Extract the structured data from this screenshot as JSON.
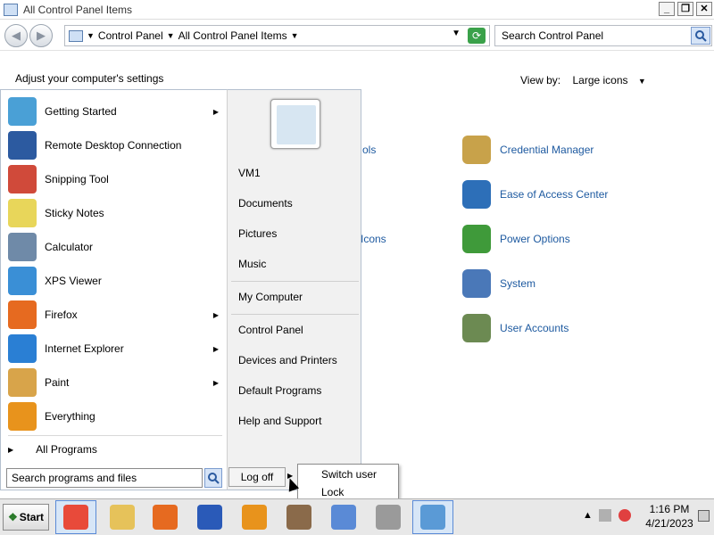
{
  "window": {
    "title": "All Control Panel Items",
    "buttons": [
      "_",
      "❐",
      "✕"
    ]
  },
  "toolbar": {
    "back_icon": "back-arrow-icon",
    "forward_icon": "forward-arrow-icon",
    "breadcrumb": [
      "Control Panel",
      "All Control Panel Items"
    ],
    "search_placeholder": "Search Control Panel"
  },
  "content": {
    "heading": "Adjust your computer's settings",
    "view_by_label": "View by:",
    "view_by_value": "Large icons",
    "partial_items": [
      "ols",
      "Icons"
    ],
    "items": [
      {
        "label": "Credential Manager",
        "color": "#c8a24a"
      },
      {
        "label": "Ease of Access Center",
        "color": "#2d6fb8"
      },
      {
        "label": "Power Options",
        "color": "#3f9a3a"
      },
      {
        "label": "System",
        "color": "#4a78b8"
      },
      {
        "label": "User Accounts",
        "color": "#6c8a52"
      }
    ]
  },
  "start_menu": {
    "programs": [
      {
        "label": "Getting Started",
        "arrow": true,
        "color": "#4aa0d6"
      },
      {
        "label": "Remote Desktop Connection",
        "arrow": false,
        "color": "#2c5aa0"
      },
      {
        "label": "Snipping Tool",
        "arrow": false,
        "color": "#d04a3a"
      },
      {
        "label": "Sticky Notes",
        "arrow": false,
        "color": "#e8d65a"
      },
      {
        "label": "Calculator",
        "arrow": false,
        "color": "#6f8aa8"
      },
      {
        "label": "XPS Viewer",
        "arrow": false,
        "color": "#3a8fd6"
      },
      {
        "label": "Firefox",
        "arrow": true,
        "color": "#e66a20"
      },
      {
        "label": "Internet Explorer",
        "arrow": true,
        "color": "#2a7fd4"
      },
      {
        "label": "Paint",
        "arrow": true,
        "color": "#d8a44a"
      },
      {
        "label": "Everything",
        "arrow": false,
        "color": "#e8931c"
      }
    ],
    "all_programs": "All Programs",
    "search_placeholder": "Search programs and files",
    "right_links_top": [
      "VM1",
      "Documents",
      "Pictures",
      "Music"
    ],
    "right_links_mid": [
      "My Computer"
    ],
    "right_links_bottom": [
      "Control Panel",
      "Devices and Printers",
      "Default Programs",
      "Help and Support"
    ],
    "log_off": "Log off",
    "flyout": [
      "Switch user",
      "Lock"
    ]
  },
  "taskbar": {
    "start_label": "Start",
    "apps": [
      {
        "name": "chrome-icon",
        "color": "#e84a3a"
      },
      {
        "name": "explorer-icon",
        "color": "#e6c25a"
      },
      {
        "name": "firefox-icon",
        "color": "#e66a20"
      },
      {
        "name": "help-icon",
        "color": "#2a5ab8"
      },
      {
        "name": "everything-icon",
        "color": "#e8931c"
      },
      {
        "name": "stamp-icon",
        "color": "#8a6a4a"
      },
      {
        "name": "wordpad-icon",
        "color": "#5a8ad6"
      },
      {
        "name": "fax-icon",
        "color": "#9a9a9a"
      },
      {
        "name": "control-panel-icon",
        "color": "#5a9ad6"
      }
    ],
    "time": "1:16 PM",
    "date": "4/21/2023"
  }
}
